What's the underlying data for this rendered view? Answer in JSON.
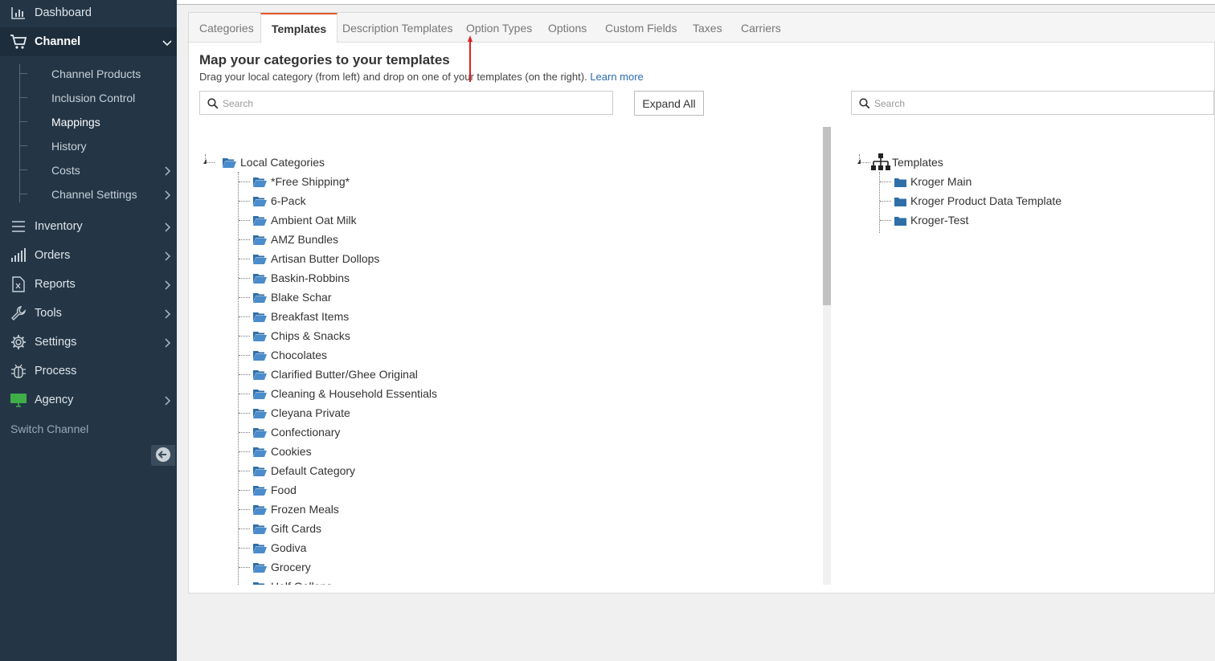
{
  "sidebar": {
    "items": [
      {
        "label": "Dashboard",
        "icon": "bar-chart-icon"
      },
      {
        "label": "Channel",
        "icon": "cart-icon"
      },
      {
        "label": "Inventory",
        "icon": "list-icon"
      },
      {
        "label": "Orders",
        "icon": "signal-bars-icon"
      },
      {
        "label": "Reports",
        "icon": "excel-file-icon"
      },
      {
        "label": "Tools",
        "icon": "wrench-icon"
      },
      {
        "label": "Settings",
        "icon": "gear-icon"
      },
      {
        "label": "Process",
        "icon": "bug-icon"
      },
      {
        "label": "Agency",
        "icon": "monitor-icon"
      }
    ],
    "channel_sub": [
      {
        "label": "Channel Products"
      },
      {
        "label": "Inclusion Control"
      },
      {
        "label": "Mappings"
      },
      {
        "label": "History"
      },
      {
        "label": "Costs"
      },
      {
        "label": "Channel Settings"
      }
    ],
    "switch_channel": "Switch Channel",
    "accent_agency": "#3fae49"
  },
  "tabs": [
    "Categories",
    "Templates",
    "Description Templates",
    "Option Types",
    "Options",
    "Custom Fields",
    "Taxes",
    "Carriers"
  ],
  "active_tab": "Templates",
  "heading": "Map your categories to your templates",
  "subheading": {
    "text": "Drag your local category (from left) and drop on one of your templates (on the right).",
    "link": "Learn more"
  },
  "left_search": {
    "placeholder": "Search"
  },
  "right_search": {
    "placeholder": "Search"
  },
  "expand_all": "Expand All",
  "local_tree": {
    "root": "Local Categories",
    "items": [
      "*Free Shipping*",
      "6-Pack",
      "Ambient Oat Milk",
      "AMZ Bundles",
      "Artisan Butter Dollops",
      "Baskin-Robbins",
      "Blake Schar",
      "Breakfast Items",
      "Chips & Snacks",
      "Chocolates",
      "Clarified Butter/Ghee Original",
      "Cleaning & Household Essentials",
      "Cleyana Private",
      "Confectionary",
      "Cookies",
      "Default Category",
      "Food",
      "Frozen Meals",
      "Gift Cards",
      "Godiva",
      "Grocery",
      "Half Gallons"
    ]
  },
  "template_tree": {
    "root": "Templates",
    "items": [
      "Kroger Main",
      "Kroger Product Data Template",
      "Kroger-Test"
    ]
  },
  "colors": {
    "sidebar_bg": "#243646",
    "tab_accent": "#e05a2b",
    "folder_blue": "#2f6fa8",
    "link": "#2a6ab0",
    "annotation_red": "#e02020"
  }
}
